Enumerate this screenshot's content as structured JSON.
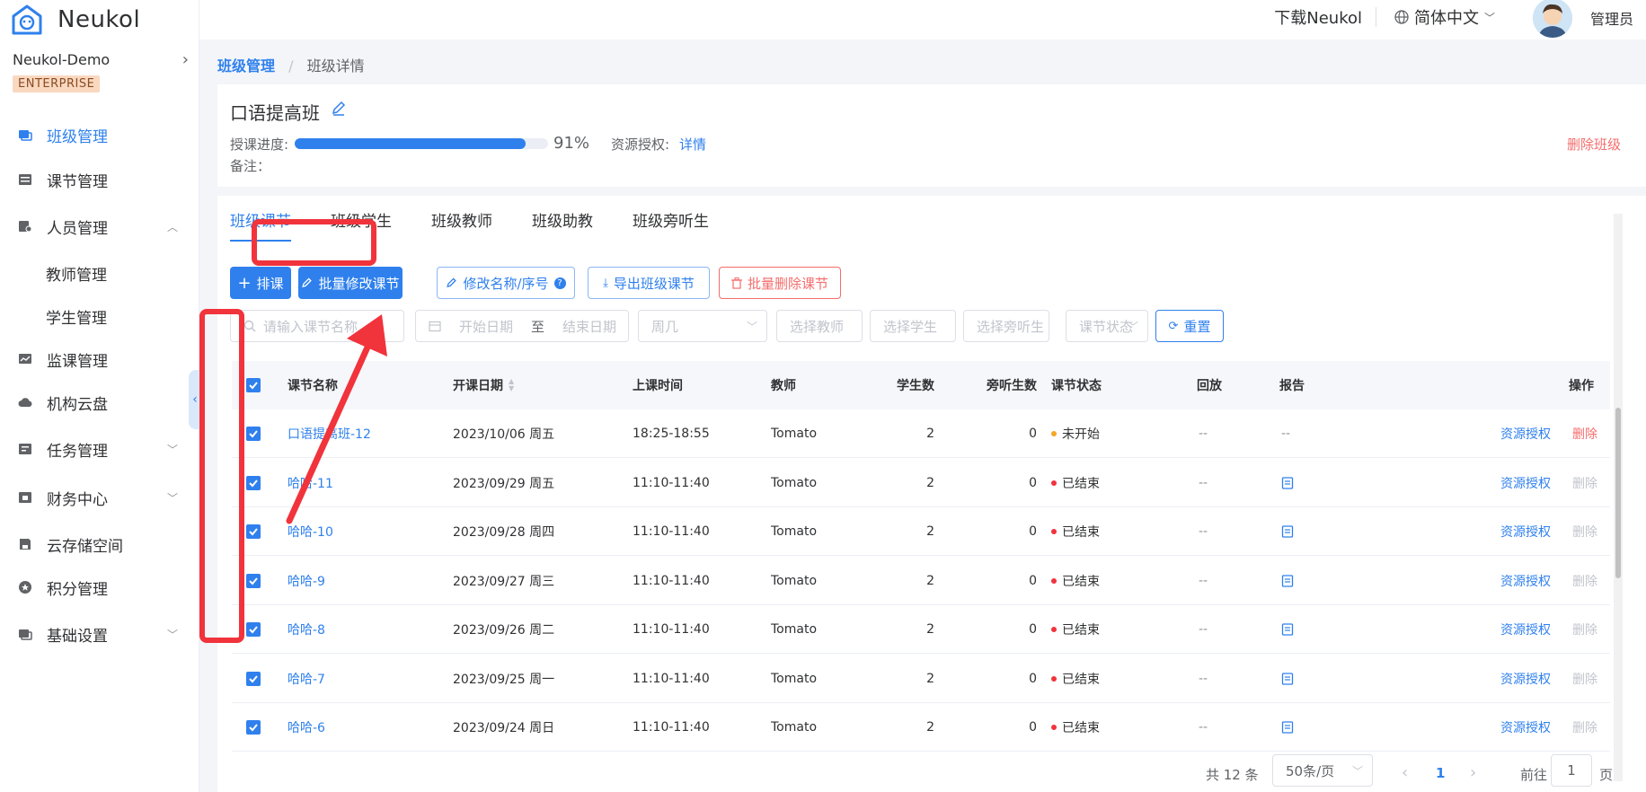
{
  "brand": {
    "name": "Neukol"
  },
  "org": {
    "name": "Neukol-Demo",
    "badge": "ENTERPRISE"
  },
  "sidebar": {
    "items": [
      {
        "label": "班级管理",
        "icon": "class-icon",
        "active": true
      },
      {
        "label": "课节管理",
        "icon": "list-icon"
      },
      {
        "label": "人员管理",
        "icon": "people-icon",
        "caret": "up"
      },
      {
        "label": "教师管理",
        "sub": true
      },
      {
        "label": "学生管理",
        "sub": true
      },
      {
        "label": "监课管理",
        "icon": "monitor-icon"
      },
      {
        "label": "机构云盘",
        "icon": "cloud-icon"
      },
      {
        "label": "任务管理",
        "icon": "task-icon",
        "caret": "down"
      },
      {
        "label": "财务中心",
        "icon": "finance-icon",
        "caret": "down"
      },
      {
        "label": "云存储空间",
        "icon": "storage-icon"
      },
      {
        "label": "积分管理",
        "icon": "points-icon"
      },
      {
        "label": "基础设置",
        "icon": "settings-icon",
        "caret": "down"
      }
    ]
  },
  "topbar": {
    "download": "下载Neukol",
    "language": "简体中文",
    "user": "管理员"
  },
  "breadcrumb": {
    "parent": "班级管理",
    "current": "班级详情"
  },
  "class_info": {
    "title": "口语提高班",
    "progress_label": "授课进度:",
    "progress_value": 0.91,
    "progress_text": "91%",
    "resource_label": "资源授权:",
    "resource_link": "详情",
    "note_label": "备注：",
    "delete": "删除班级"
  },
  "tabs": [
    "班级课节",
    "班级学生",
    "班级教师",
    "班级助教",
    "班级旁听生"
  ],
  "toolbar": {
    "schedule": "排课",
    "batch_edit": "批量修改课节",
    "rename": "修改名称/序号",
    "export": "导出班级课节",
    "batch_delete": "批量删除课节"
  },
  "filters": {
    "name_placeholder": "请输入课节名称",
    "start_date": "开始日期",
    "to": "至",
    "end_date": "结束日期",
    "weekday": "周几",
    "teacher": "选择教师",
    "student": "选择学生",
    "auditor": "选择旁听生",
    "status": "课节状态",
    "reset": "重置"
  },
  "table": {
    "headers": {
      "name": "课节名称",
      "date": "开课日期",
      "time": "上课时间",
      "teacher": "教师",
      "students": "学生数",
      "auditors": "旁听生数",
      "status": "课节状态",
      "replay": "回放",
      "report": "报告",
      "ops": "操作"
    },
    "rows": [
      {
        "name": "口语提高班-12",
        "date": "2023/10/06 周五",
        "time": "18:25-18:55",
        "teacher": "Tomato",
        "students": "2",
        "auditors": "0",
        "status": "未开始",
        "status_color": "#f5a623",
        "replay": "--",
        "report": "--",
        "auth": "资源授权",
        "del": "删除",
        "del_enabled": true
      },
      {
        "name": "哈哈-11",
        "date": "2023/09/29 周五",
        "time": "11:10-11:40",
        "teacher": "Tomato",
        "students": "2",
        "auditors": "0",
        "status": "已结束",
        "status_color": "#f1333c",
        "replay": "--",
        "report": "report-icon",
        "auth": "资源授权",
        "del": "删除",
        "del_enabled": false
      },
      {
        "name": "哈哈-10",
        "date": "2023/09/28 周四",
        "time": "11:10-11:40",
        "teacher": "Tomato",
        "students": "2",
        "auditors": "0",
        "status": "已结束",
        "status_color": "#f1333c",
        "replay": "--",
        "report": "report-icon",
        "auth": "资源授权",
        "del": "删除",
        "del_enabled": false
      },
      {
        "name": "哈哈-9",
        "date": "2023/09/27 周三",
        "time": "11:10-11:40",
        "teacher": "Tomato",
        "students": "2",
        "auditors": "0",
        "status": "已结束",
        "status_color": "#f1333c",
        "replay": "--",
        "report": "report-icon",
        "auth": "资源授权",
        "del": "删除",
        "del_enabled": false
      },
      {
        "name": "哈哈-8",
        "date": "2023/09/26 周二",
        "time": "11:10-11:40",
        "teacher": "Tomato",
        "students": "2",
        "auditors": "0",
        "status": "已结束",
        "status_color": "#f1333c",
        "replay": "--",
        "report": "report-icon",
        "auth": "资源授权",
        "del": "删除",
        "del_enabled": false
      },
      {
        "name": "哈哈-7",
        "date": "2023/09/25 周一",
        "time": "11:10-11:40",
        "teacher": "Tomato",
        "students": "2",
        "auditors": "0",
        "status": "已结束",
        "status_color": "#f1333c",
        "replay": "--",
        "report": "report-icon",
        "auth": "资源授权",
        "del": "删除",
        "del_enabled": false
      },
      {
        "name": "哈哈-6",
        "date": "2023/09/24 周日",
        "time": "11:10-11:40",
        "teacher": "Tomato",
        "students": "2",
        "auditors": "0",
        "status": "已结束",
        "status_color": "#f1333c",
        "replay": "--",
        "report": "report-icon",
        "auth": "资源授权",
        "del": "删除",
        "del_enabled": false
      }
    ]
  },
  "pagination": {
    "total": "共 12 条",
    "page_size": "50条/页",
    "current_page": "1",
    "goto_label": "前往",
    "goto_value": "1",
    "page_unit": "页"
  },
  "colors": {
    "accent": "#2f80ed",
    "danger": "#f56c6c",
    "annotation": "#f1333c"
  }
}
